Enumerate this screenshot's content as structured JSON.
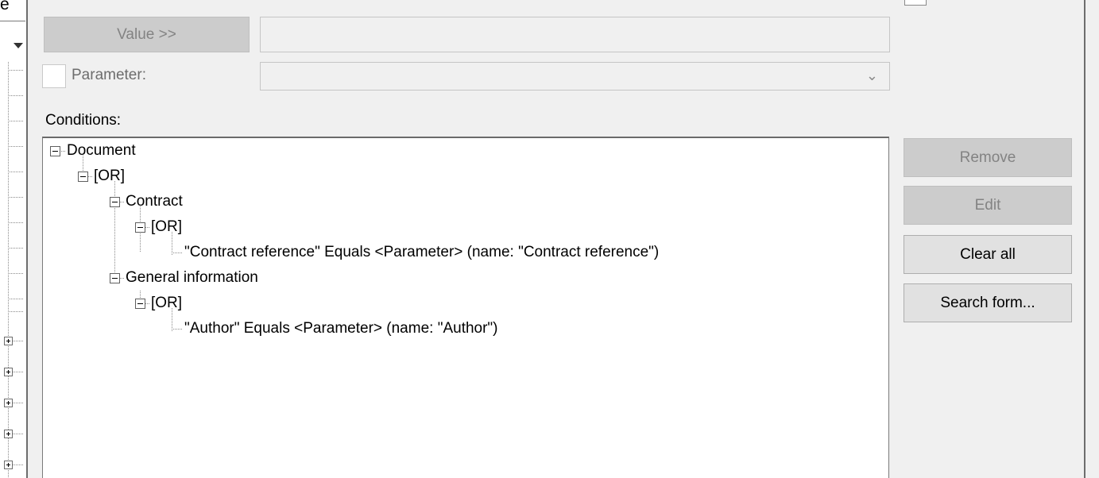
{
  "edge": {
    "letter": "e"
  },
  "value_row": {
    "button_label": "Value >>",
    "input_value": ""
  },
  "parameter_row": {
    "label": "Parameter:",
    "checked": false,
    "selected": ""
  },
  "conditions": {
    "label": "Conditions:",
    "tree": {
      "root": "Document",
      "or1": "[OR]",
      "contract": "Contract",
      "or2": "[OR]",
      "contract_condition": "\"Contract reference\" Equals <Parameter> (name: \"Contract reference\")",
      "general": "General information",
      "or3": "[OR]",
      "author_condition": "\"Author\" Equals <Parameter> (name: \"Author\")"
    }
  },
  "actions": {
    "remove": "Remove",
    "edit": "Edit",
    "clear_all": "Clear all",
    "search_form": "Search form..."
  },
  "icons": {
    "dropdown": "chevron-down-icon",
    "collapse": "minus-box-icon",
    "expand": "plus-box-icon"
  }
}
